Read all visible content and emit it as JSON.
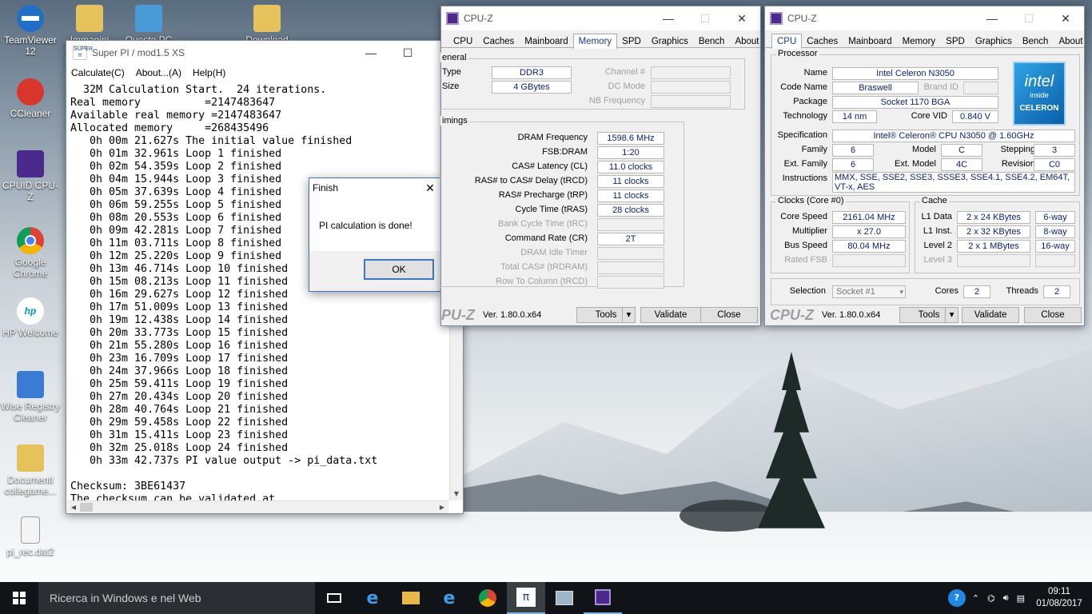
{
  "desktop": {
    "icons": [
      {
        "label": "TeamViewer 12"
      },
      {
        "label": "Immagini"
      },
      {
        "label": "Questo PC"
      },
      {
        "label": "Download"
      },
      {
        "label": "CCleaner"
      },
      {
        "label": "CPUID CPU-Z"
      },
      {
        "label": "Google Chrome"
      },
      {
        "label": "HP Welcome"
      },
      {
        "label": "Wise Registry Cleaner"
      },
      {
        "label": "Documenti collegame..."
      },
      {
        "label": "pi_rec.dat2"
      }
    ]
  },
  "superpi": {
    "title": "Super PI / mod1.5 XS",
    "menu": [
      "Calculate(C)",
      "About...(A)",
      "Help(H)"
    ],
    "lines": [
      "  32M Calculation Start.  24 iterations.",
      "Real memory          =2147483647",
      "Available real memory =2147483647",
      "Allocated memory     =268435496",
      "   0h 00m 21.627s The initial value finished",
      "   0h 01m 32.961s Loop 1 finished",
      "   0h 02m 54.359s Loop 2 finished",
      "   0h 04m 15.944s Loop 3 finished",
      "   0h 05m 37.639s Loop 4 finished",
      "   0h 06m 59.255s Loop 5 finished",
      "   0h 08m 20.553s Loop 6 finished",
      "   0h 09m 42.281s Loop 7 finished",
      "   0h 11m 03.711s Loop 8 finished",
      "   0h 12m 25.220s Loop 9 finished",
      "   0h 13m 46.714s Loop 10 finished",
      "   0h 15m 08.213s Loop 11 finished",
      "   0h 16m 29.627s Loop 12 finished",
      "   0h 17m 51.009s Loop 13 finished",
      "   0h 19m 12.438s Loop 14 finished",
      "   0h 20m 33.773s Loop 15 finished",
      "   0h 21m 55.280s Loop 16 finished",
      "   0h 23m 16.709s Loop 17 finished",
      "   0h 24m 37.966s Loop 18 finished",
      "   0h 25m 59.411s Loop 19 finished",
      "   0h 27m 20.434s Loop 20 finished",
      "   0h 28m 40.764s Loop 21 finished",
      "   0h 29m 59.458s Loop 22 finished",
      "   0h 31m 15.411s Loop 23 finished",
      "   0h 32m 25.018s Loop 24 finished",
      "   0h 33m 42.737s PI value output -> pi_data.txt",
      "",
      "Checksum: 3BE61437",
      "The checksum can be validated at"
    ]
  },
  "dialog": {
    "title": "Finish",
    "message": "PI calculation is done!",
    "ok": "OK"
  },
  "cpuz_mem": {
    "title": "CPU-Z",
    "tabs": [
      "CPU",
      "Caches",
      "Mainboard",
      "Memory",
      "SPD",
      "Graphics",
      "Bench",
      "About"
    ],
    "active_tab": "Memory",
    "general_label": "eneral",
    "type_label": "Type",
    "type": "DDR3",
    "size_label": "Size",
    "size": "4 GBytes",
    "channel_label": "Channel #",
    "dcmode_label": "DC Mode",
    "nbfreq_label": "NB Frequency",
    "timings_label": "imings",
    "timings": [
      {
        "label": "DRAM Frequency",
        "value": "1598.6 MHz",
        "dim": false
      },
      {
        "label": "FSB:DRAM",
        "value": "1:20",
        "dim": false
      },
      {
        "label": "CAS# Latency (CL)",
        "value": "11.0 clocks",
        "dim": false
      },
      {
        "label": "RAS# to CAS# Delay (tRCD)",
        "value": "11 clocks",
        "dim": false
      },
      {
        "label": "RAS# Precharge (tRP)",
        "value": "11 clocks",
        "dim": false
      },
      {
        "label": "Cycle Time (tRAS)",
        "value": "28 clocks",
        "dim": false
      },
      {
        "label": "Bank Cycle Time (tRC)",
        "value": "",
        "dim": true
      },
      {
        "label": "Command Rate (CR)",
        "value": "2T",
        "dim": false
      },
      {
        "label": "DRAM Idle Timer",
        "value": "",
        "dim": true
      },
      {
        "label": "Total CAS# (tRDRAM)",
        "value": "",
        "dim": true
      },
      {
        "label": "Row To Column (tRCD)",
        "value": "",
        "dim": true
      }
    ],
    "logo": "PU-Z",
    "version": "Ver. 1.80.0.x64",
    "tools": "Tools",
    "validate": "Validate",
    "close": "Close"
  },
  "cpuz_cpu": {
    "title": "CPU-Z",
    "tabs": [
      "CPU",
      "Caches",
      "Mainboard",
      "Memory",
      "SPD",
      "Graphics",
      "Bench",
      "About"
    ],
    "active_tab": "CPU",
    "processor_label": "Processor",
    "name_label": "Name",
    "name": "Intel Celeron N3050",
    "codename_label": "Code Name",
    "codename": "Braswell",
    "brandid_label": "Brand ID",
    "package_label": "Package",
    "package": "Socket 1170 BGA",
    "technology_label": "Technology",
    "technology": "14 nm",
    "corevid_label": "Core VID",
    "corevid": "0.840 V",
    "spec_label": "Specification",
    "spec": "Intel® Celeron® CPU  N3050  @ 1.60GHz",
    "family_label": "Family",
    "family": "6",
    "model_label": "Model",
    "model": "C",
    "stepping_label": "Stepping",
    "stepping": "3",
    "extfamily_label": "Ext. Family",
    "extfamily": "6",
    "extmodel_label": "Ext. Model",
    "extmodel": "4C",
    "revision_label": "Revision",
    "revision": "C0",
    "instr_label": "Instructions",
    "instr": "MMX, SSE, SSE2, SSE3, SSSE3, SSE4.1, SSE4.2, EM64T, VT-x, AES",
    "clocks_label": "Clocks (Core #0)",
    "corespeed_label": "Core Speed",
    "corespeed": "2161.04 MHz",
    "multiplier_label": "Multiplier",
    "multiplier": "x 27.0",
    "busspeed_label": "Bus Speed",
    "busspeed": "80.04 MHz",
    "ratedfsb_label": "Rated FSB",
    "cache_label": "Cache",
    "l1d_label": "L1 Data",
    "l1d": "2 x 24 KBytes",
    "l1d_way": "6-way",
    "l1i_label": "L1 Inst.",
    "l1i": "2 x 32 KBytes",
    "l1i_way": "8-way",
    "l2_label": "Level 2",
    "l2": "2 x 1 MBytes",
    "l2_way": "16-way",
    "l3_label": "Level 3",
    "selection_label": "Selection",
    "selection": "Socket #1",
    "cores_label": "Cores",
    "cores": "2",
    "threads_label": "Threads",
    "threads": "2",
    "intel_logo": {
      "brand": "intel",
      "line1": "inside",
      "line2": "CELERON"
    },
    "logo": "CPU-Z",
    "version": "Ver. 1.80.0.x64",
    "tools": "Tools",
    "validate": "Validate",
    "close": "Close"
  },
  "taskbar": {
    "search_placeholder": "Ricerca in Windows e nel Web",
    "time": "09:11",
    "date": "01/08/2017"
  }
}
